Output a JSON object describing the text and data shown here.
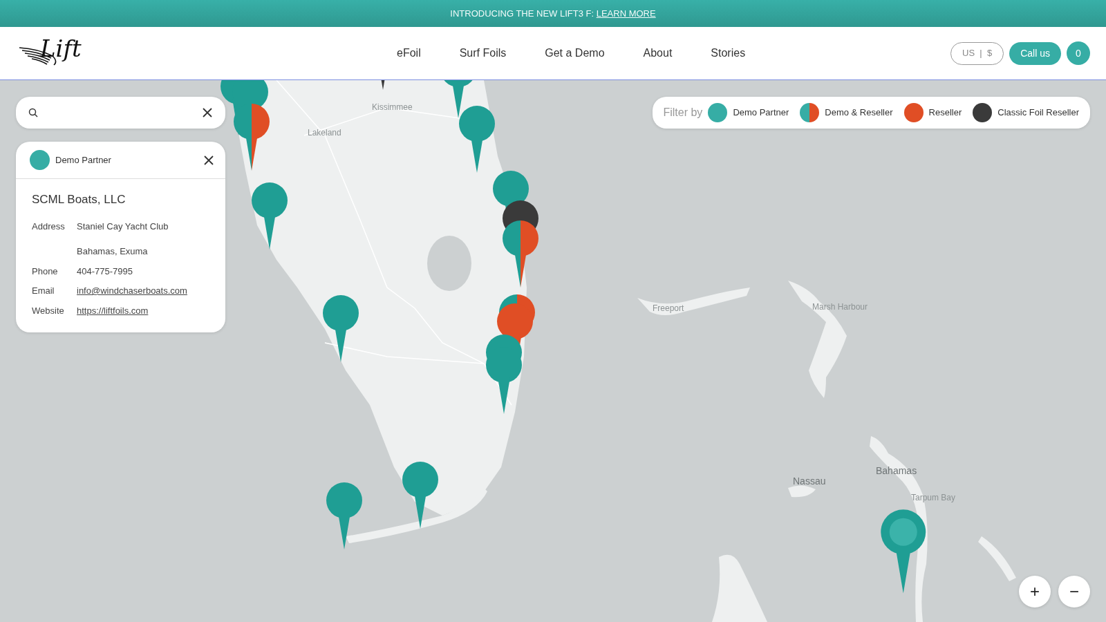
{
  "announcement": {
    "text": "INTRODUCING THE NEW LIFT3 F:",
    "link": "LEARN MORE"
  },
  "header": {
    "logo_text": "Lift",
    "nav": [
      "eFoil",
      "Surf Foils",
      "Get a Demo",
      "About",
      "Stories"
    ],
    "currency": "US  |  $",
    "call_button": "Call us",
    "cart_count": "0"
  },
  "detail_card": {
    "category": {
      "kind": "demo",
      "label": "Demo Partner"
    },
    "name": "SCML Boats, LLC",
    "fields": [
      {
        "label": "Address",
        "kind": "text",
        "values": [
          "Staniel Cay Yacht Club",
          "Bahamas, Exuma"
        ]
      },
      {
        "label": "Phone",
        "kind": "text",
        "values": [
          "404-775-7995"
        ]
      },
      {
        "label": "Email",
        "kind": "link",
        "values": [
          "info@windchaserboats.com"
        ]
      },
      {
        "label": "Website",
        "kind": "link",
        "values": [
          "https://liftfoils.com"
        ]
      }
    ]
  },
  "filter": {
    "label": "Filter by",
    "items": [
      {
        "kind": "demo",
        "label": "Demo Partner"
      },
      {
        "kind": "both",
        "label": "Demo & Reseller"
      },
      {
        "kind": "reseller",
        "label": "Reseller"
      },
      {
        "kind": "classic",
        "label": "Classic Foil Reseller"
      }
    ]
  },
  "map": {
    "labels": [
      "Kissimmee",
      "Lakeland",
      "Freeport",
      "Marsh Harbour",
      "Nassau",
      "Bahamas",
      "Tarpum Bay"
    ],
    "pins": [
      {
        "kind": "demo",
        "selected": false
      },
      {
        "kind": "demo",
        "selected": false
      },
      {
        "kind": "both",
        "selected": false
      },
      {
        "kind": "demo",
        "selected": false
      },
      {
        "kind": "classic",
        "selected": false
      },
      {
        "kind": "demo",
        "selected": false
      },
      {
        "kind": "demo",
        "selected": false
      },
      {
        "kind": "demo",
        "selected": false
      },
      {
        "kind": "classic",
        "selected": false
      },
      {
        "kind": "both",
        "selected": false
      },
      {
        "kind": "both",
        "selected": false
      },
      {
        "kind": "reseller",
        "selected": false
      },
      {
        "kind": "demo",
        "selected": false
      },
      {
        "kind": "demo",
        "selected": false
      },
      {
        "kind": "demo",
        "selected": false
      },
      {
        "kind": "demo",
        "selected": false
      },
      {
        "kind": "demo",
        "selected": false
      },
      {
        "kind": "demo",
        "selected": true
      }
    ],
    "zoom_in": "+",
    "zoom_out": "−"
  }
}
